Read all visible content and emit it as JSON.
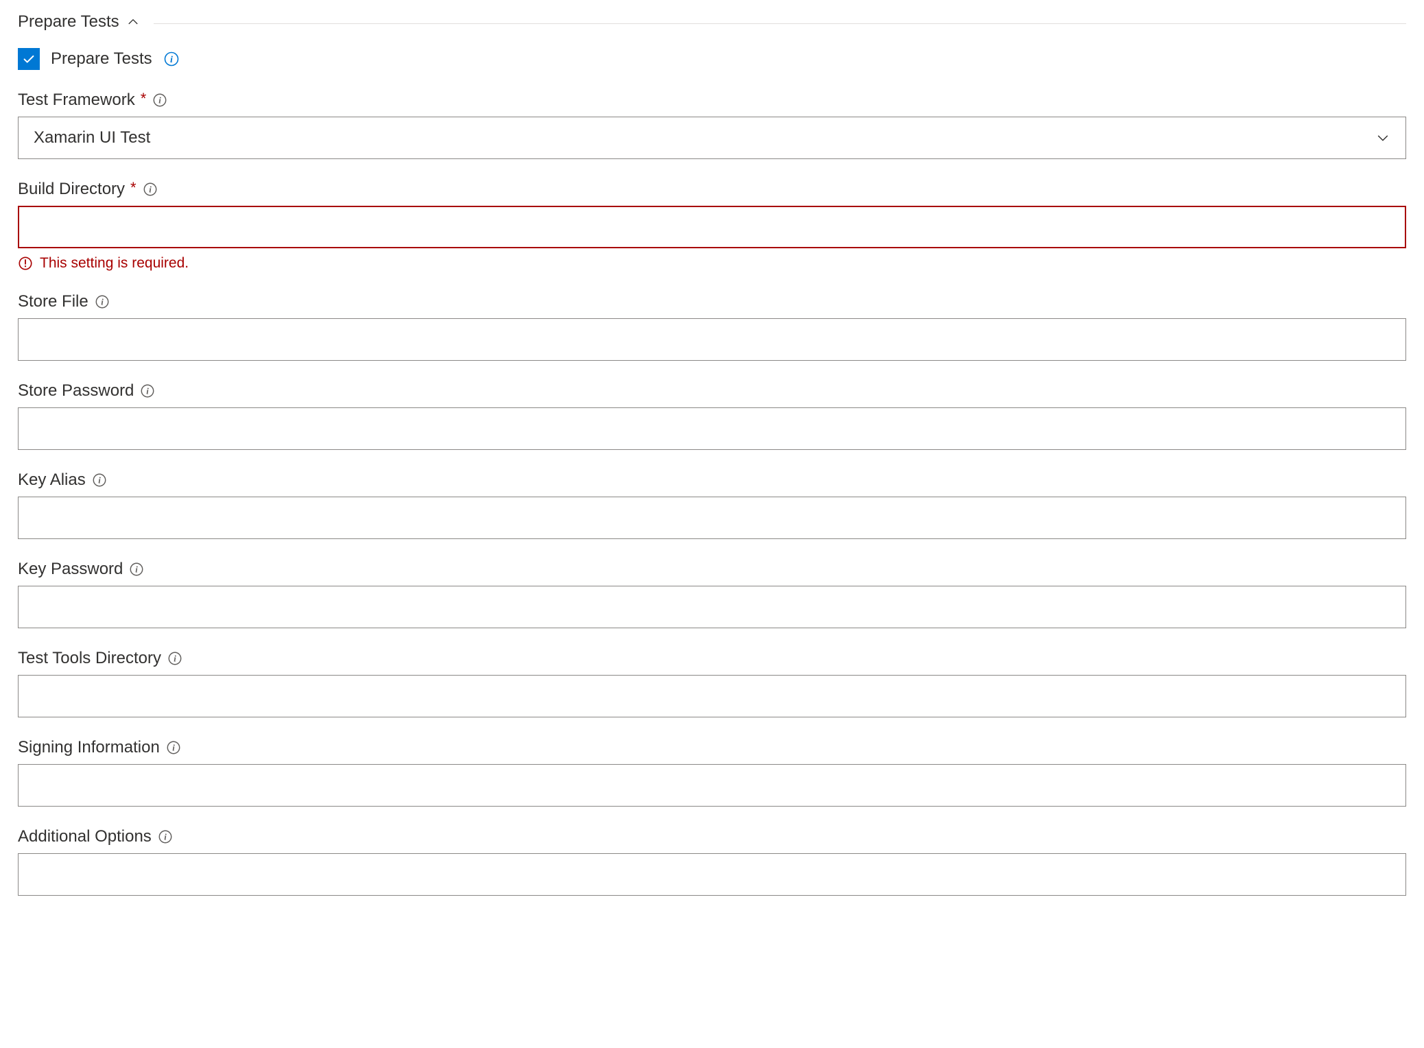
{
  "section": {
    "title": "Prepare Tests"
  },
  "checkbox": {
    "label": "Prepare Tests",
    "checked": true
  },
  "fields": {
    "testFramework": {
      "label": "Test Framework",
      "required": true,
      "value": "Xamarin UI Test"
    },
    "buildDirectory": {
      "label": "Build Directory",
      "required": true,
      "value": "",
      "errorMessage": "This setting is required."
    },
    "storeFile": {
      "label": "Store File",
      "value": ""
    },
    "storePassword": {
      "label": "Store Password",
      "value": ""
    },
    "keyAlias": {
      "label": "Key Alias",
      "value": ""
    },
    "keyPassword": {
      "label": "Key Password",
      "value": ""
    },
    "testToolsDirectory": {
      "label": "Test Tools Directory",
      "value": ""
    },
    "signingInformation": {
      "label": "Signing Information",
      "value": ""
    },
    "additionalOptions": {
      "label": "Additional Options",
      "value": ""
    }
  }
}
